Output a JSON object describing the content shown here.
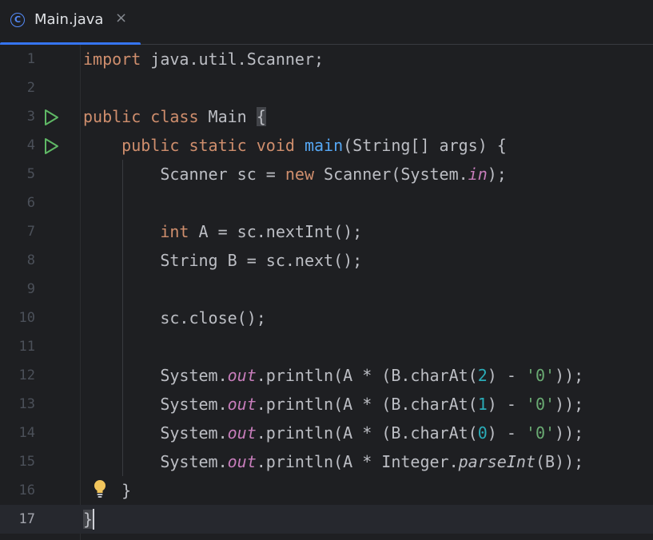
{
  "tab": {
    "icon_letter": "C",
    "title": "Main.java",
    "close_glyph": "×",
    "accent": "#3574f0"
  },
  "editor": {
    "lines": [
      {
        "num": "1"
      },
      {
        "num": "2"
      },
      {
        "num": "3",
        "run_icon": "run-class-icon"
      },
      {
        "num": "4",
        "run_icon": "run-main-icon"
      },
      {
        "num": "5"
      },
      {
        "num": "6"
      },
      {
        "num": "7"
      },
      {
        "num": "8"
      },
      {
        "num": "9"
      },
      {
        "num": "10"
      },
      {
        "num": "11"
      },
      {
        "num": "12"
      },
      {
        "num": "13"
      },
      {
        "num": "14"
      },
      {
        "num": "15"
      },
      {
        "num": "16",
        "gutter_icon": "intention-bulb-icon"
      },
      {
        "num": "17",
        "current": true
      }
    ],
    "code": {
      "l1": {
        "a": "import",
        "b": " java.util.Scanner;"
      },
      "l3": {
        "a": "public class",
        "b": " Main ",
        "c": "{"
      },
      "l4": {
        "a": "    public static void ",
        "b": "main",
        "c": "(String[] args) {"
      },
      "l5": {
        "a": "        Scanner sc = ",
        "b": "new",
        "c": " Scanner(System.",
        "d": "in",
        "e": ");"
      },
      "l7": {
        "a": "        int",
        "b": " A = sc.nextInt();"
      },
      "l8": {
        "a": "        String B = sc.next();"
      },
      "l10": {
        "a": "        sc.close();"
      },
      "l12": {
        "a": "        System.",
        "b": "out",
        "c": ".println(A * (B.charAt(",
        "d": "2",
        "e": ") - ",
        "f": "'0'",
        "g": "));"
      },
      "l13": {
        "a": "        System.",
        "b": "out",
        "c": ".println(A * (B.charAt(",
        "d": "1",
        "e": ") - ",
        "f": "'0'",
        "g": "));"
      },
      "l14": {
        "a": "        System.",
        "b": "out",
        "c": ".println(A * (B.charAt(",
        "d": "0",
        "e": ") - ",
        "f": "'0'",
        "g": "));"
      },
      "l15": {
        "a": "        System.",
        "b": "out",
        "c": ".println(A * Integer.",
        "d": "parseInt",
        "e": "(B));"
      },
      "l16": {
        "a": "    }"
      },
      "l17": {
        "a": "}"
      }
    }
  },
  "colors": {
    "keyword": "#cf8e6d",
    "method_decl": "#56a8f5",
    "static_field": "#c77dbb",
    "number": "#2aacb8",
    "string": "#6aab73",
    "run_icon": "#5fb865",
    "bulb": "#f2c55c"
  }
}
